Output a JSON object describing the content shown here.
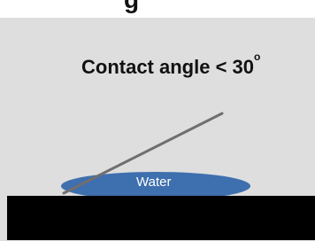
{
  "heading_fragment": "g",
  "diagram": {
    "title_text": "Contact angle < 30",
    "title_superscript": "o",
    "water_label": "Water"
  },
  "colors": {
    "panel_background": "#dedede",
    "water_drop": "#3e6fae",
    "tangent_line": "#6f6f6f",
    "redaction_bar": "#000000",
    "text": "#111111"
  }
}
